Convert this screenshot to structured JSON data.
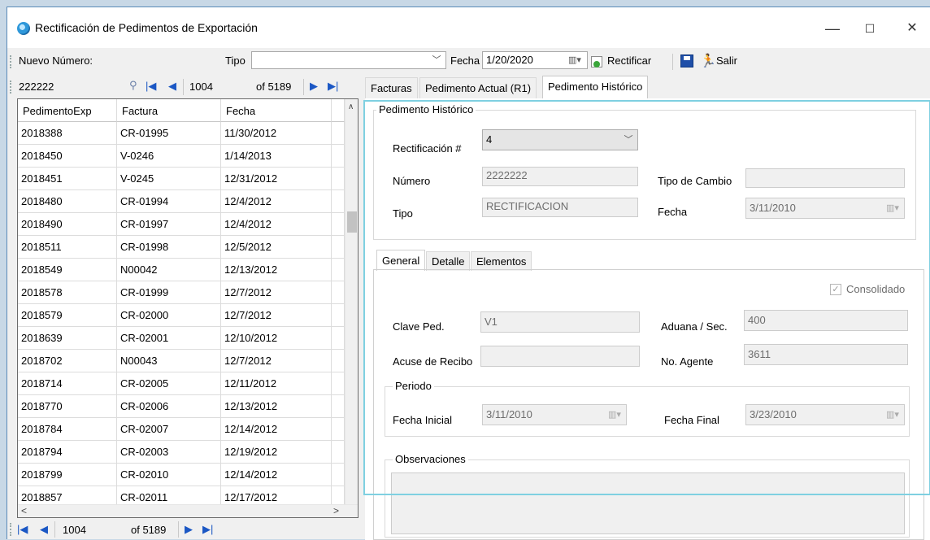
{
  "window": {
    "title": "Rectificación de Pedimentos de Exportación",
    "minimize": "—",
    "maximize": "☐",
    "close": "✕"
  },
  "toolbar": {
    "nuevo_numero_label": "Nuevo Número:",
    "tipo_label": "Tipo",
    "tipo_value": "",
    "fecha_label": "Fecha",
    "fecha_value": "1/20/2020",
    "rectificar_label": "Rectificar",
    "salir_label": "Salir"
  },
  "nav": {
    "search_value": "222222",
    "position": "1004",
    "total": "of 5189"
  },
  "tabs": [
    "Facturas",
    "Pedimento Actual (R1)",
    "Pedimento Histórico"
  ],
  "grid": {
    "headers": [
      "PedimentoExp",
      "Factura",
      "Fecha"
    ],
    "rows": [
      [
        "2018388",
        "CR-01995",
        "11/30/2012"
      ],
      [
        "2018450",
        "V-0246",
        "1/14/2013"
      ],
      [
        "2018451",
        "V-0245",
        "12/31/2012"
      ],
      [
        "2018480",
        "CR-01994",
        "12/4/2012"
      ],
      [
        "2018490",
        "CR-01997",
        "12/4/2012"
      ],
      [
        "2018511",
        "CR-01998",
        "12/5/2012"
      ],
      [
        "2018549",
        "N00042",
        "12/13/2012"
      ],
      [
        "2018578",
        "CR-01999",
        "12/7/2012"
      ],
      [
        "2018579",
        "CR-02000",
        "12/7/2012"
      ],
      [
        "2018639",
        "CR-02001",
        "12/10/2012"
      ],
      [
        "2018702",
        "N00043",
        "12/7/2012"
      ],
      [
        "2018714",
        "CR-02005",
        "12/11/2012"
      ],
      [
        "2018770",
        "CR-02006",
        "12/13/2012"
      ],
      [
        "2018784",
        "CR-02007",
        "12/14/2012"
      ],
      [
        "2018794",
        "CR-02003",
        "12/19/2012"
      ],
      [
        "2018799",
        "CR-02010",
        "12/14/2012"
      ],
      [
        "2018857",
        "CR-02011",
        "12/17/2012"
      ]
    ]
  },
  "historico": {
    "group_title": "Pedimento Histórico",
    "rectificacion_label": "Rectificación #",
    "rectificacion_value": "4",
    "numero_label": "Número",
    "numero_value": "2222222",
    "tipo_cambio_label": "Tipo de Cambio",
    "tipo_cambio_value": "",
    "tipo_label": "Tipo",
    "tipo_value": "RECTIFICACION",
    "fecha_label": "Fecha",
    "fecha_value": "3/11/2010"
  },
  "subtabs": [
    "General",
    "Detalle",
    "Elementos"
  ],
  "general": {
    "consolidado_label": "Consolidado",
    "clave_ped_label": "Clave Ped.",
    "clave_ped_value": "V1",
    "aduana_label": "Aduana / Sec.",
    "aduana_value": "400",
    "acuse_label": "Acuse de Recibo",
    "acuse_value": "",
    "agente_label": "No. Agente",
    "agente_value": "3611",
    "periodo_title": "Periodo",
    "fecha_inicial_label": "Fecha Inicial",
    "fecha_inicial_value": "3/11/2010",
    "fecha_final_label": "Fecha Final",
    "fecha_final_value": "3/23/2010",
    "observaciones_title": "Observaciones"
  },
  "status": {
    "position": "1004",
    "total": "of 5189"
  },
  "colors": {
    "accent_blue": "#1b57c4",
    "highlight": "#7fd0e1"
  }
}
